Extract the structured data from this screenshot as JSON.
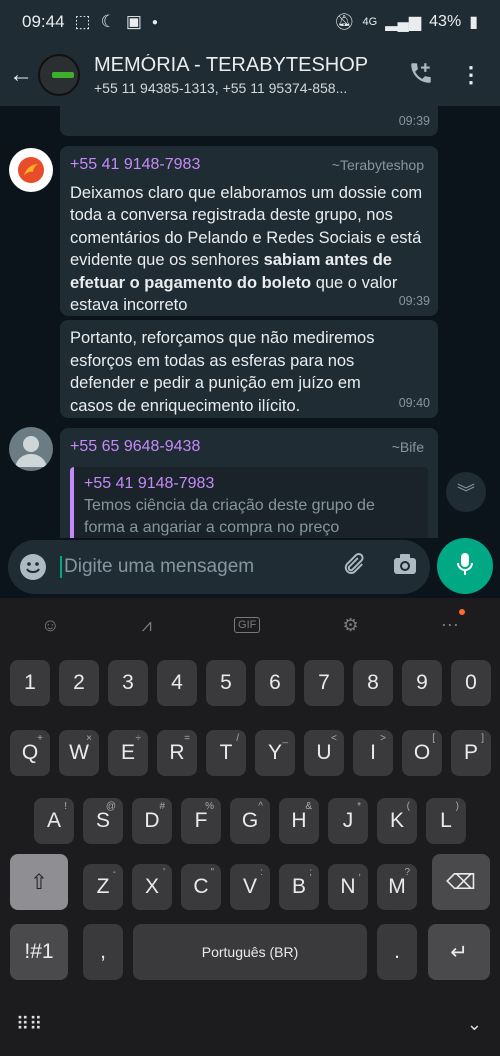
{
  "status": {
    "time": "09:44",
    "battery": "43%",
    "network": "4G"
  },
  "header": {
    "title": "MEMÓRIA - TERABYTESHOP",
    "subtitle": "+55 11 94385-1313, +55 11 95374-858..."
  },
  "messages": [
    {
      "time": "09:39"
    },
    {
      "sender": "+55 41 9148-7983",
      "pushname": "~Terabyteshop",
      "text_plain": "Deixamos claro que elaboramos um dossie com toda a conversa registrada deste grupo, nos comentários do Pelando e Redes Sociais e está evidente que os senhores",
      "text_bold": "sabiam antes de efetuar o pagamento do boleto",
      "text_tail": " que o valor estava incorreto",
      "time": "09:39"
    },
    {
      "text": "Portanto, reforçamos que não mediremos esforços em todas as esferas para nos defender e pedir a punição em juízo em casos de enriquecimento ilícito.",
      "time": "09:40"
    },
    {
      "sender": "+55 65 9648-9438",
      "pushname": "~Bife",
      "quote_sender": "+55 41 9148-7983",
      "quote_text": "Temos ciência da criação deste grupo de forma a angariar a compra no preço"
    }
  ],
  "input": {
    "placeholder": "Digite uma mensagem"
  },
  "keyboard": {
    "numbers": [
      "1",
      "2",
      "3",
      "4",
      "5",
      "6",
      "7",
      "8",
      "9",
      "0"
    ],
    "row1": [
      "Q",
      "W",
      "E",
      "R",
      "T",
      "Y",
      "U",
      "I",
      "O",
      "P"
    ],
    "row1_alt": [
      "+",
      "×",
      "÷",
      "=",
      "/",
      "_",
      "<",
      ">",
      "[",
      "]"
    ],
    "row2": [
      "A",
      "S",
      "D",
      "F",
      "G",
      "H",
      "J",
      "K",
      "L"
    ],
    "row2_alt": [
      "!",
      "@",
      "#",
      "%",
      "^",
      "&",
      "*",
      "(",
      ")"
    ],
    "row3": [
      "Z",
      "X",
      "C",
      "V",
      "B",
      "N",
      "M"
    ],
    "row3_alt": [
      "-",
      "'",
      "\"",
      ":",
      ";",
      ",",
      "?"
    ],
    "symbols_key": "!#1",
    "comma_key": ",",
    "space_label": "Português (BR)",
    "period_key": "."
  },
  "colors": {
    "accent": "#00a884",
    "sender_name": "#c58af9"
  }
}
